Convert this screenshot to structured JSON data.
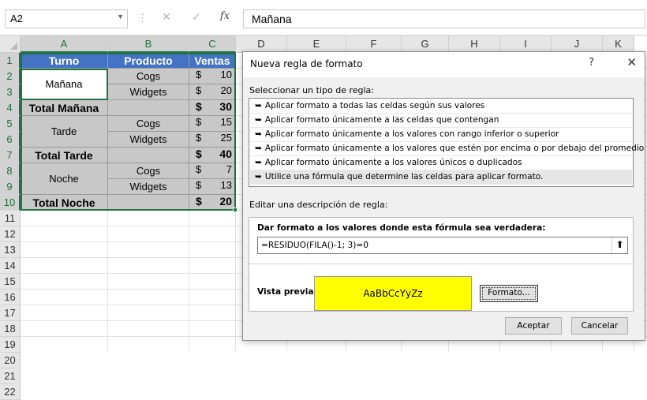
{
  "formula_bar": {
    "name_box": "A2",
    "cancel_glyph": "✕",
    "enter_glyph": "✓",
    "fx_label": "fx",
    "formula": "Mañana"
  },
  "columns": [
    "A",
    "B",
    "C",
    "D",
    "E",
    "F",
    "G",
    "H",
    "I",
    "J",
    "K"
  ],
  "rows": [
    "1",
    "2",
    "3",
    "4",
    "5",
    "6",
    "7",
    "8",
    "9",
    "10",
    "11",
    "12",
    "13",
    "14",
    "15",
    "16",
    "17",
    "18",
    "19",
    "20",
    "21",
    "22"
  ],
  "table": {
    "headers": [
      "Turno",
      "Producto",
      "Ventas"
    ],
    "currency": "$",
    "cells": {
      "a2": "Mañana",
      "b2": "Cogs",
      "c2": "10",
      "b3": "Widgets",
      "c3": "20",
      "a4": "Total Mañana",
      "c4": "30",
      "a5": "Tarde",
      "b5": "Cogs",
      "c5": "15",
      "b6": "Widgets",
      "c6": "25",
      "a7": "Total Tarde",
      "c7": "40",
      "a8": "Noche",
      "b8": "Cogs",
      "c8": "7",
      "b9": "Widgets",
      "c9": "13",
      "a10": "Total Noche",
      "c10": "20"
    }
  },
  "dialog": {
    "title": "Nueva regla de formato",
    "help": "?",
    "close": "✕",
    "select_label": "Seleccionar un tipo de regla:",
    "rule_types": [
      "Aplicar formato a todas las celdas según sus valores",
      "Aplicar formato únicamente a las celdas que contengan",
      "Aplicar formato únicamente a los valores con rango inferior o superior",
      "Aplicar formato únicamente a los valores que estén por encima o por debajo del promedio",
      "Aplicar formato únicamente a los valores únicos o duplicados",
      "Utilice una fórmula que determine las celdas para aplicar formato."
    ],
    "bullet": "➥",
    "selected_rule_index": 5,
    "edit_label": "Editar una descripción de regla:",
    "formula_label": "Dar formato a los valores donde esta fórmula sea verdadera:",
    "formula_value": "=RESIDUO(FILA()-1; 3)=0",
    "ref_button": "⬆",
    "preview_label": "Vista previa:",
    "preview_text": "AaBbCcYyZz",
    "preview_color": "#ffff00",
    "format_button": "Formato...",
    "ok_button": "Aceptar",
    "cancel_button": "Cancelar"
  }
}
